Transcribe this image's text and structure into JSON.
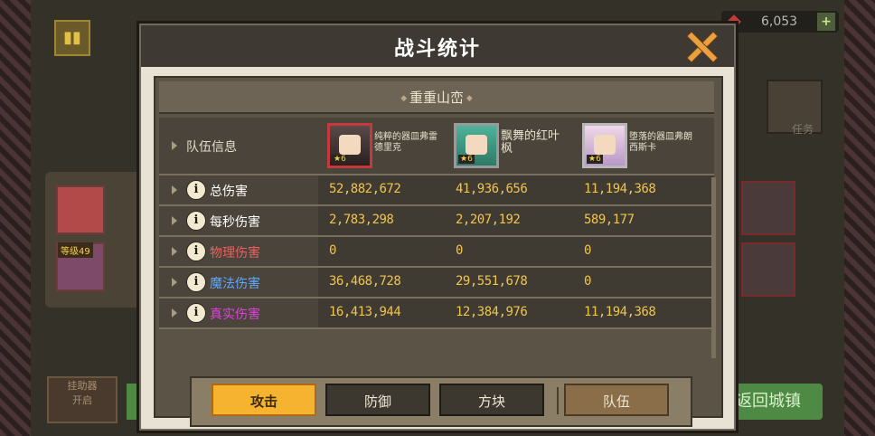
{
  "background": {
    "currency_amount": "6,053",
    "currency_plus": "+",
    "task_label": "任务",
    "level_badge": "等级49",
    "back_button": "返回城镇",
    "helper_title": "挂助器",
    "helper_action": "开启"
  },
  "dialog": {
    "title": "战斗统计",
    "subtitle": "重重山峦",
    "info_symbol": "i",
    "team_header_label": "队伍信息",
    "members": [
      {
        "name": "纯粹的器皿弗雷德里克",
        "stars": "★6"
      },
      {
        "name": "飘舞的红叶 枫",
        "stars": "★6"
      },
      {
        "name": "堕落的器皿弗朗西斯卡",
        "stars": "★6"
      }
    ],
    "rows": [
      {
        "label": "总伤害",
        "values": [
          "52,882,672",
          "41,936,656",
          "11,194,368"
        ]
      },
      {
        "label": "每秒伤害",
        "values": [
          "2,783,298",
          "2,207,192",
          "589,177"
        ]
      },
      {
        "label": "物理伤害",
        "values": [
          "0",
          "0",
          "0"
        ]
      },
      {
        "label": "魔法伤害",
        "values": [
          "36,468,728",
          "29,551,678",
          "0"
        ]
      },
      {
        "label": "真实伤害",
        "values": [
          "16,413,944",
          "12,384,976",
          "11,194,368"
        ]
      }
    ],
    "tabs": {
      "attack": "攻击",
      "defense": "防御",
      "block": "方块",
      "team": "队伍"
    }
  },
  "colors": {
    "value_gold": "#f2c54a",
    "physical": "#e86060",
    "magic": "#5ea8ff",
    "true_damage": "#e040e0",
    "active_tab": "#f5b330"
  }
}
